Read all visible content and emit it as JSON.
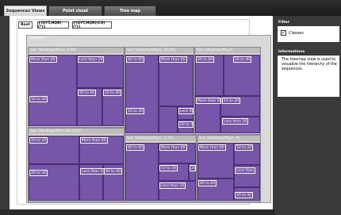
{
  "tabs": [
    {
      "label": "Sequences Views",
      "state": "active"
    },
    {
      "label": "Point cloud",
      "state": "inactive"
    },
    {
      "label": "Tree map",
      "state": "inactive"
    }
  ],
  "toolbar": {
    "root_label": "Root",
    "seq1_label": "{(QYT,HQR)(*)}",
    "seq2_label": "{(QYT,HQR)(CS)(*)}"
  },
  "treemap": {
    "root_label": "Classes",
    "groups": [
      {
        "label": "Sol: (Studing)(Mycl, 2,86)",
        "cells": [
          "More than 60",
          "Less than 10",
          "40 to 60",
          "20 to 40",
          "10 to 20"
        ]
      },
      {
        "label": "Sol: (Studing)(Mycl, 25,05)",
        "cells": [
          "40 to 60",
          "More than 60",
          "10 to 20",
          "Less th",
          "20 to 4"
        ]
      },
      {
        "label": "Sol: (Studing)(Mycl)",
        "cells": [
          "40 to 60",
          "20 to 40",
          "More than 60",
          "10 to 20",
          "Less than 10"
        ]
      },
      {
        "label": "Sol: (Studing)(Mycl,18,20)(*)",
        "cells": [
          "10 to 20",
          "More than 60",
          "20 to 40",
          "Less than 10",
          "40 to 60"
        ]
      },
      {
        "label": "Sol: (Studing)(Mycl, 2,21)",
        "cells": [
          "40 to 60",
          "More than 60",
          "10 to 20",
          "20",
          "Less than 10"
        ]
      },
      {
        "label": "Sol: (Studing)(Mycl, 4)",
        "cells": [
          "More than 60",
          "10 to 20",
          "Less than",
          "40 to 60",
          "20 to 40"
        ]
      }
    ]
  },
  "filter": {
    "title": "Filter",
    "checkbox_label": "Classes",
    "checked": true,
    "check_glyph": "✓"
  },
  "informations": {
    "title": "Informations",
    "text": "The treemap view is used to visualize the hierarchy of the sequences."
  },
  "colors": {
    "cell": "#7755a8",
    "background": "#3a3a3a"
  }
}
